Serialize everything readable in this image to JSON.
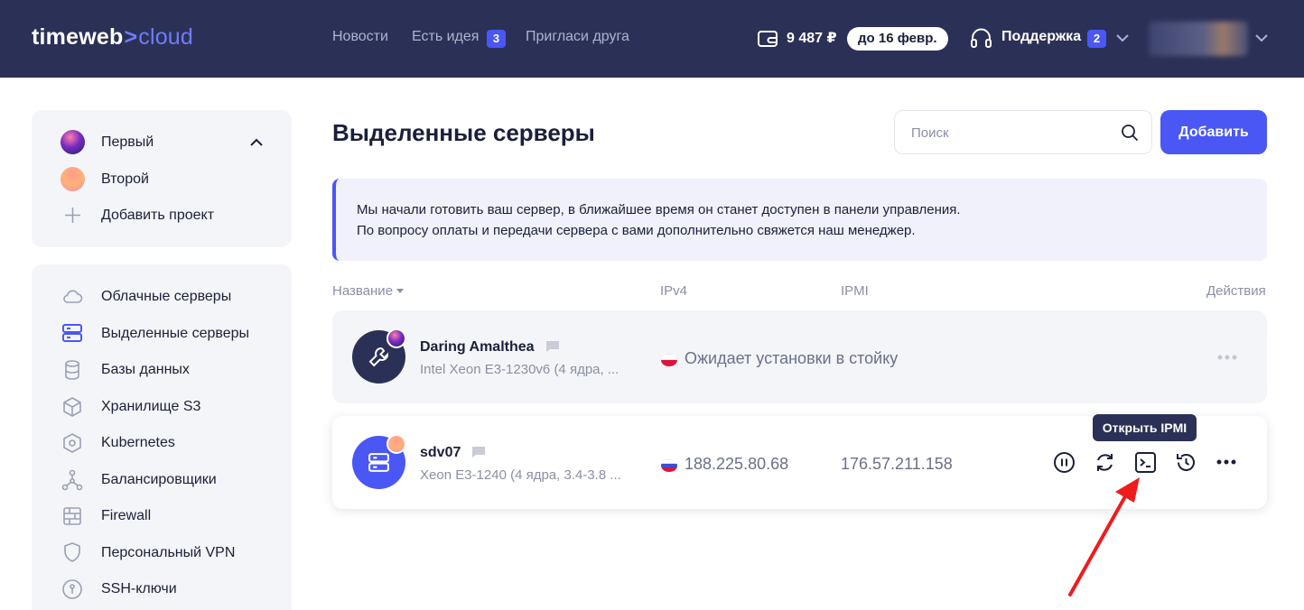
{
  "header": {
    "logo_main": "timeweb",
    "logo_arrow": ">",
    "logo_sub": "cloud",
    "nav": {
      "news": "Новости",
      "idea": "Есть идея",
      "idea_count": "3",
      "invite": "Пригласи друга"
    },
    "balance": "9 487 ₽",
    "balance_until": "до 16 февр.",
    "support": "Поддержка",
    "support_count": "2"
  },
  "sidebar": {
    "projects": [
      {
        "label": "Первый"
      },
      {
        "label": "Второй"
      }
    ],
    "add_project": "Добавить проект",
    "menu": [
      {
        "label": "Облачные серверы",
        "icon": "cloud-icon"
      },
      {
        "label": "Выделенные серверы",
        "icon": "server-icon"
      },
      {
        "label": "Базы данных",
        "icon": "database-icon"
      },
      {
        "label": "Хранилище S3",
        "icon": "cube-icon"
      },
      {
        "label": "Kubernetes",
        "icon": "kubernetes-icon"
      },
      {
        "label": "Балансировщики",
        "icon": "balancer-icon"
      },
      {
        "label": "Firewall",
        "icon": "firewall-icon"
      },
      {
        "label": "Персональный VPN",
        "icon": "shield-icon"
      },
      {
        "label": "SSH-ключи",
        "icon": "key-icon"
      }
    ]
  },
  "main": {
    "title": "Выделенные серверы",
    "search_placeholder": "Поиск",
    "add_button": "Добавить",
    "notice_line1": "Мы начали готовить ваш сервер, в ближайшее время он станет доступен в панели управления.",
    "notice_line2": "По вопросу оплаты и передачи сервера с вами дополнительно свяжется наш менеджер.",
    "columns": {
      "name": "Название",
      "ipv4": "IPv4",
      "ipmi": "IPMI",
      "actions": "Действия"
    },
    "servers": [
      {
        "name": "Daring Amalthea",
        "spec": "Intel Xeon E3-1230v6 (4 ядра, ...",
        "status": "Ожидает установки в стойку",
        "flag": "poland"
      },
      {
        "name": "sdv07",
        "spec": "Xeon E3-1240 (4 ядра, 3.4-3.8 ...",
        "ipv4": "188.225.80.68",
        "ipmi": "176.57.211.158",
        "flag": "russia"
      }
    ],
    "tooltip": "Открыть IPMI"
  },
  "colors": {
    "header_bg": "#2b3156",
    "accent": "#4a57f5",
    "arrow_red": "#f01b1b"
  }
}
